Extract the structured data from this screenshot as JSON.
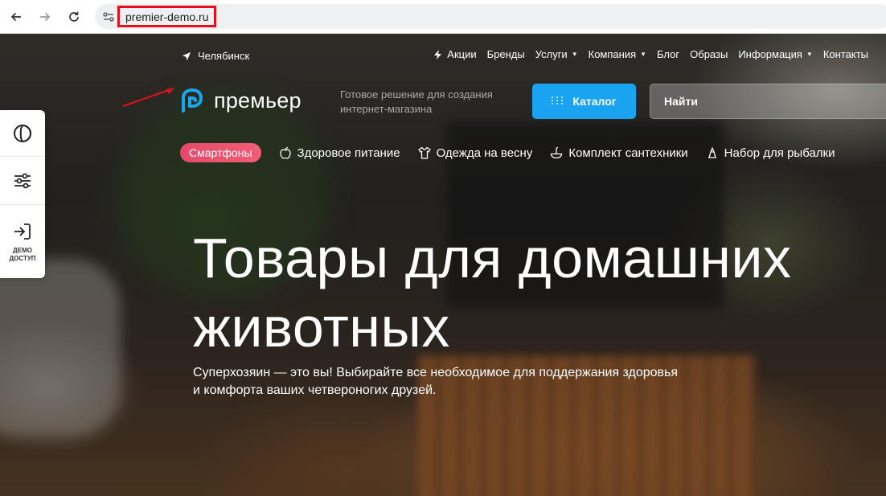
{
  "browser": {
    "url": "premier-demo.ru"
  },
  "header": {
    "city": "Челябинск",
    "nav": [
      {
        "label": "Акции",
        "has_dropdown": false,
        "icon": "lightning-icon"
      },
      {
        "label": "Бренды",
        "has_dropdown": false
      },
      {
        "label": "Услуги",
        "has_dropdown": true
      },
      {
        "label": "Компания",
        "has_dropdown": true
      },
      {
        "label": "Блог",
        "has_dropdown": false
      },
      {
        "label": "Образы",
        "has_dropdown": false
      },
      {
        "label": "Информация",
        "has_dropdown": true
      },
      {
        "label": "Контакты",
        "has_dropdown": false
      }
    ],
    "logo_text": "премьер",
    "tagline": "Готовое решение для создания интернет-магазина",
    "catalog_label": "Каталог",
    "search_placeholder": "Найти"
  },
  "categories": [
    {
      "label": "Смартфоны",
      "highlighted": true
    },
    {
      "label": "Здоровое питание",
      "icon": "apple-icon"
    },
    {
      "label": "Одежда на весну",
      "icon": "tshirt-icon"
    },
    {
      "label": "Комплект сантехники",
      "icon": "faucet-icon"
    },
    {
      "label": "Набор для рыбалки",
      "icon": "fishing-icon"
    }
  ],
  "side_widget": {
    "demo_label_line1": "ДЕМО",
    "demo_label_line2": "ДОСТУП"
  },
  "hero": {
    "title_line1": "Товары для домашних",
    "title_line2": "животных",
    "subtitle_line1": "Суперхозяин — это вы! Выбирайте все необходимое для поддержания здоровья",
    "subtitle_line2": "и комфорта ваших четвероногих друзей."
  },
  "colors": {
    "accent": "#19a3f0",
    "chip": "#e64a6a",
    "annotation": "#e3101b"
  }
}
